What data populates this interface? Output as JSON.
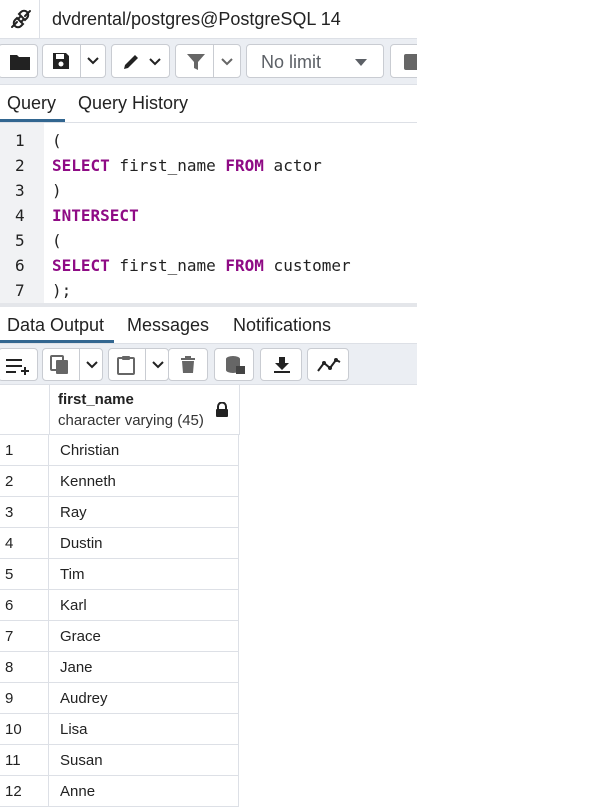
{
  "connection": {
    "label": "dvdrental/postgres@PostgreSQL 14"
  },
  "toolbar": {
    "limit_select_value": "No limit",
    "colors": {
      "background": "#ebeef3",
      "border": "#c9ccd2",
      "icon": "#222222"
    }
  },
  "query_tabs": [
    {
      "label": "Query",
      "active": true
    },
    {
      "label": "Query History",
      "active": false
    }
  ],
  "editor": {
    "lines": [
      {
        "number": "1",
        "text": "("
      },
      {
        "number": "2",
        "keyword1": "SELECT",
        "mid": " first_name ",
        "keyword2": "FROM",
        "tail": " actor"
      },
      {
        "number": "3",
        "text": ")"
      },
      {
        "number": "4",
        "keyword1": "INTERSECT"
      },
      {
        "number": "5",
        "text": "("
      },
      {
        "number": "6",
        "keyword1": "SELECT",
        "mid": " first_name ",
        "keyword2": "FROM",
        "tail": " customer"
      },
      {
        "number": "7",
        "text": ");"
      }
    ],
    "keyword_color": "#8f0b85"
  },
  "output_tabs": [
    {
      "label": "Data Output",
      "active": true
    },
    {
      "label": "Messages",
      "active": false
    },
    {
      "label": "Notifications",
      "active": false
    }
  ],
  "grid": {
    "column": {
      "name": "first_name",
      "type": "character varying (45)"
    },
    "rows": [
      {
        "num": "1",
        "value": "Christian"
      },
      {
        "num": "2",
        "value": "Kenneth"
      },
      {
        "num": "3",
        "value": "Ray"
      },
      {
        "num": "4",
        "value": "Dustin"
      },
      {
        "num": "5",
        "value": "Tim"
      },
      {
        "num": "6",
        "value": "Karl"
      },
      {
        "num": "7",
        "value": "Grace"
      },
      {
        "num": "8",
        "value": "Jane"
      },
      {
        "num": "9",
        "value": "Audrey"
      },
      {
        "num": "10",
        "value": "Lisa"
      },
      {
        "num": "11",
        "value": "Susan"
      },
      {
        "num": "12",
        "value": "Anne"
      }
    ]
  },
  "accent_color": "#326690"
}
